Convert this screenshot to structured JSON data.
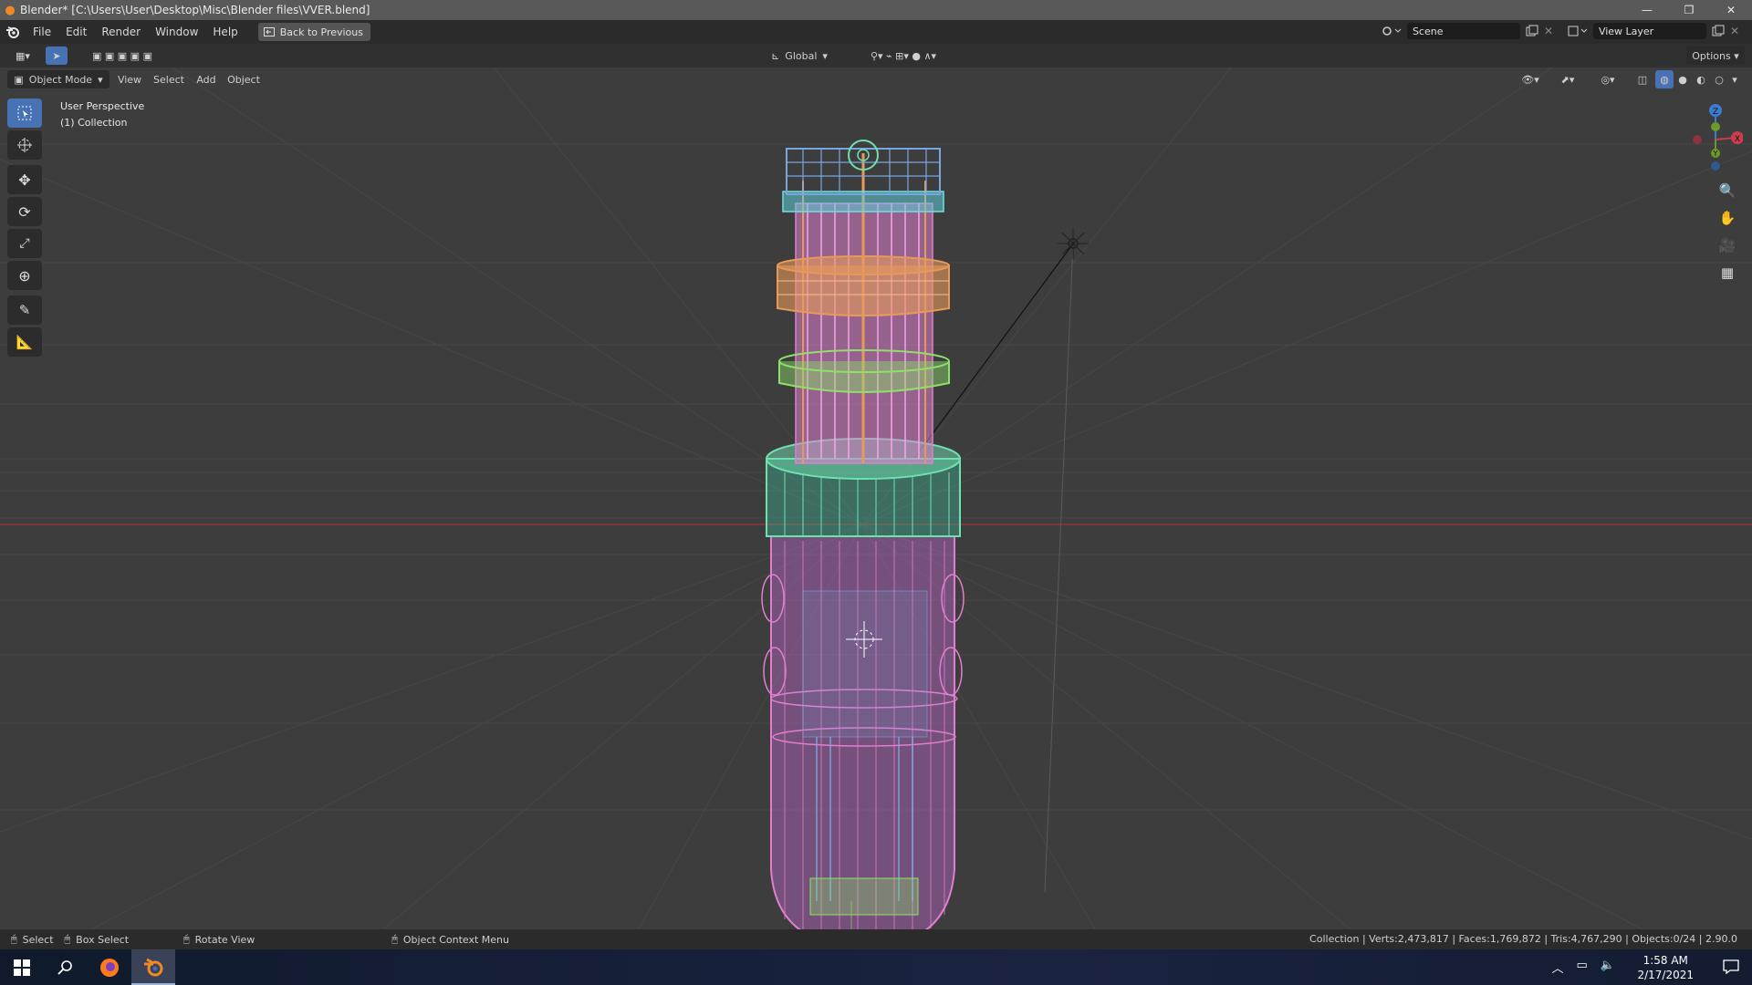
{
  "window": {
    "title": "Blender* [C:\\Users\\User\\Desktop\\Misc\\Blender files\\VVER.blend]",
    "controls": [
      "—",
      "❐",
      "✕"
    ]
  },
  "menu": {
    "items": [
      "File",
      "Edit",
      "Render",
      "Window",
      "Help"
    ],
    "back_button": "Back to Previous",
    "scene": "Scene",
    "view_layer": "View Layer"
  },
  "header": {
    "transform_orientation": "Global",
    "options": "Options",
    "mode": "Object Mode",
    "menus": [
      "View",
      "Select",
      "Add",
      "Object"
    ]
  },
  "viewport": {
    "perspective": "User Perspective",
    "collection": "(1) Collection",
    "gizmo_axes": [
      "Z",
      "Y",
      "X"
    ],
    "colors": {
      "background": "#3d3d3d",
      "grid": "#484848",
      "x_axis": "#a23a3a",
      "y_axis": "#6a9a2a",
      "wire_pink": "#e07fd0",
      "wire_orange": "#e69a5a",
      "wire_green": "#8fe06a",
      "wire_teal": "#6fe0b0",
      "wire_blue": "#7aa6e0",
      "wire_violet": "#c77de8"
    }
  },
  "statusbar": {
    "select": "Select",
    "box_select": "Box Select",
    "rotate": "Rotate View",
    "context": "Object Context Menu",
    "stats": "Collection | Verts:2,473,817 | Faces:1,769,872 | Tris:4,767,290 | Objects:0/24 | 2.90.0"
  },
  "taskbar": {
    "time": "1:58 AM",
    "date": "2/17/2021",
    "apps": [
      "windows-start",
      "search",
      "firefox",
      "blender"
    ]
  }
}
